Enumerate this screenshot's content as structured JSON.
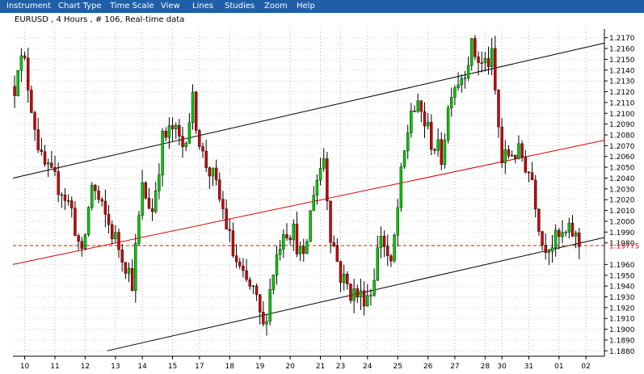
{
  "menu": {
    "items": [
      "Instrument",
      "Chart Type",
      "Time Scale",
      "View",
      "Lines",
      "Studies",
      "Zoom",
      "Help"
    ]
  },
  "chart_header": "EURUSD , 4 Hours , # 106, Real-time data",
  "colors": {
    "menu_bg": "#1f5fa8",
    "bull": "#00c800",
    "bear": "#c80000",
    "channel_lines": "#000000",
    "mid_line": "#e00000",
    "price_line": "#ff0000"
  },
  "chart_data": {
    "type": "candlestick",
    "title": "EURUSD , 4 Hours , # 106, Real-time data",
    "x_tick_labels": [
      "10",
      "11",
      "12",
      "13",
      "14",
      "15",
      "17",
      "18",
      "19",
      "20",
      "21",
      "23",
      "24",
      "25",
      "26",
      "27",
      "28",
      "30",
      "31",
      "01",
      "02"
    ],
    "x_tick_bar_index": [
      3,
      12,
      21,
      30,
      38,
      47,
      55,
      64,
      73,
      82,
      91,
      97,
      105,
      114,
      123,
      131,
      140,
      145,
      153,
      162,
      170
    ],
    "y_tick_labels": [
      "1.2170",
      "1.2160",
      "1.2150",
      "1.2140",
      "1.2130",
      "1.2120",
      "1.2110",
      "1.2100",
      "1.2090",
      "1.2080",
      "1.2070",
      "1.2060",
      "1.2050",
      "1.2040",
      "1.2030",
      "1.2020",
      "1.2010",
      "1.2000",
      "1.1990",
      "1.1980",
      "1.1960",
      "1.1950",
      "1.1940",
      "1.1930",
      "1.1920",
      "1.1910",
      "1.1900",
      "1.1890",
      "1.1880"
    ],
    "ylim": [
      1.1875,
      1.2178
    ],
    "current_price": "1.19775",
    "current_price_value": 1.19775,
    "bar_count": 176,
    "ohlc_keyframes": [
      [
        0,
        1.2125
      ],
      [
        1,
        1.215
      ],
      [
        3,
        1.2145
      ],
      [
        6,
        1.209
      ],
      [
        8,
        1.2055
      ],
      [
        11,
        1.204
      ],
      [
        14,
        1.203
      ],
      [
        17,
        1.201
      ],
      [
        20,
        1.1965
      ],
      [
        23,
        1.2035
      ],
      [
        26,
        1.201
      ],
      [
        29,
        1.199
      ],
      [
        32,
        1.197
      ],
      [
        35,
        1.1945
      ],
      [
        38,
        1.203
      ],
      [
        41,
        1.201
      ],
      [
        44,
        1.2075
      ],
      [
        47,
        1.2085
      ],
      [
        50,
        1.207
      ],
      [
        53,
        1.211
      ],
      [
        56,
        1.206
      ],
      [
        59,
        1.204
      ],
      [
        62,
        1.201
      ],
      [
        65,
        1.197
      ],
      [
        68,
        1.1945
      ],
      [
        71,
        1.1935
      ],
      [
        74,
        1.19
      ],
      [
        77,
        1.1955
      ],
      [
        80,
        1.1995
      ],
      [
        83,
        1.199
      ],
      [
        86,
        1.196
      ],
      [
        89,
        1.203
      ],
      [
        92,
        1.206
      ],
      [
        94,
        1.199
      ],
      [
        97,
        1.195
      ],
      [
        100,
        1.1935
      ],
      [
        103,
        1.193
      ],
      [
        106,
        1.1935
      ],
      [
        109,
        1.199
      ],
      [
        112,
        1.1955
      ],
      [
        115,
        1.204
      ],
      [
        118,
        1.2105
      ],
      [
        121,
        1.21
      ],
      [
        124,
        1.2075
      ],
      [
        127,
        1.206
      ],
      [
        130,
        1.2125
      ],
      [
        133,
        1.2135
      ],
      [
        136,
        1.216
      ],
      [
        139,
        1.2145
      ],
      [
        142,
        1.215
      ],
      [
        145,
        1.2055
      ],
      [
        148,
        1.2065
      ],
      [
        151,
        1.206
      ],
      [
        154,
        1.204
      ],
      [
        157,
        1.198
      ],
      [
        160,
        1.198
      ],
      [
        163,
        1.1985
      ],
      [
        166,
        1.199
      ],
      [
        168,
        1.1978
      ]
    ],
    "channel_upper": [
      [
        1.204,
        0
      ],
      [
        1.2165,
        176
      ]
    ],
    "channel_mid": [
      [
        1.196,
        0
      ],
      [
        1.2075,
        176
      ]
    ],
    "channel_lower": [
      [
        1.188,
        28
      ],
      [
        1.1985,
        176
      ]
    ],
    "grid": true
  }
}
